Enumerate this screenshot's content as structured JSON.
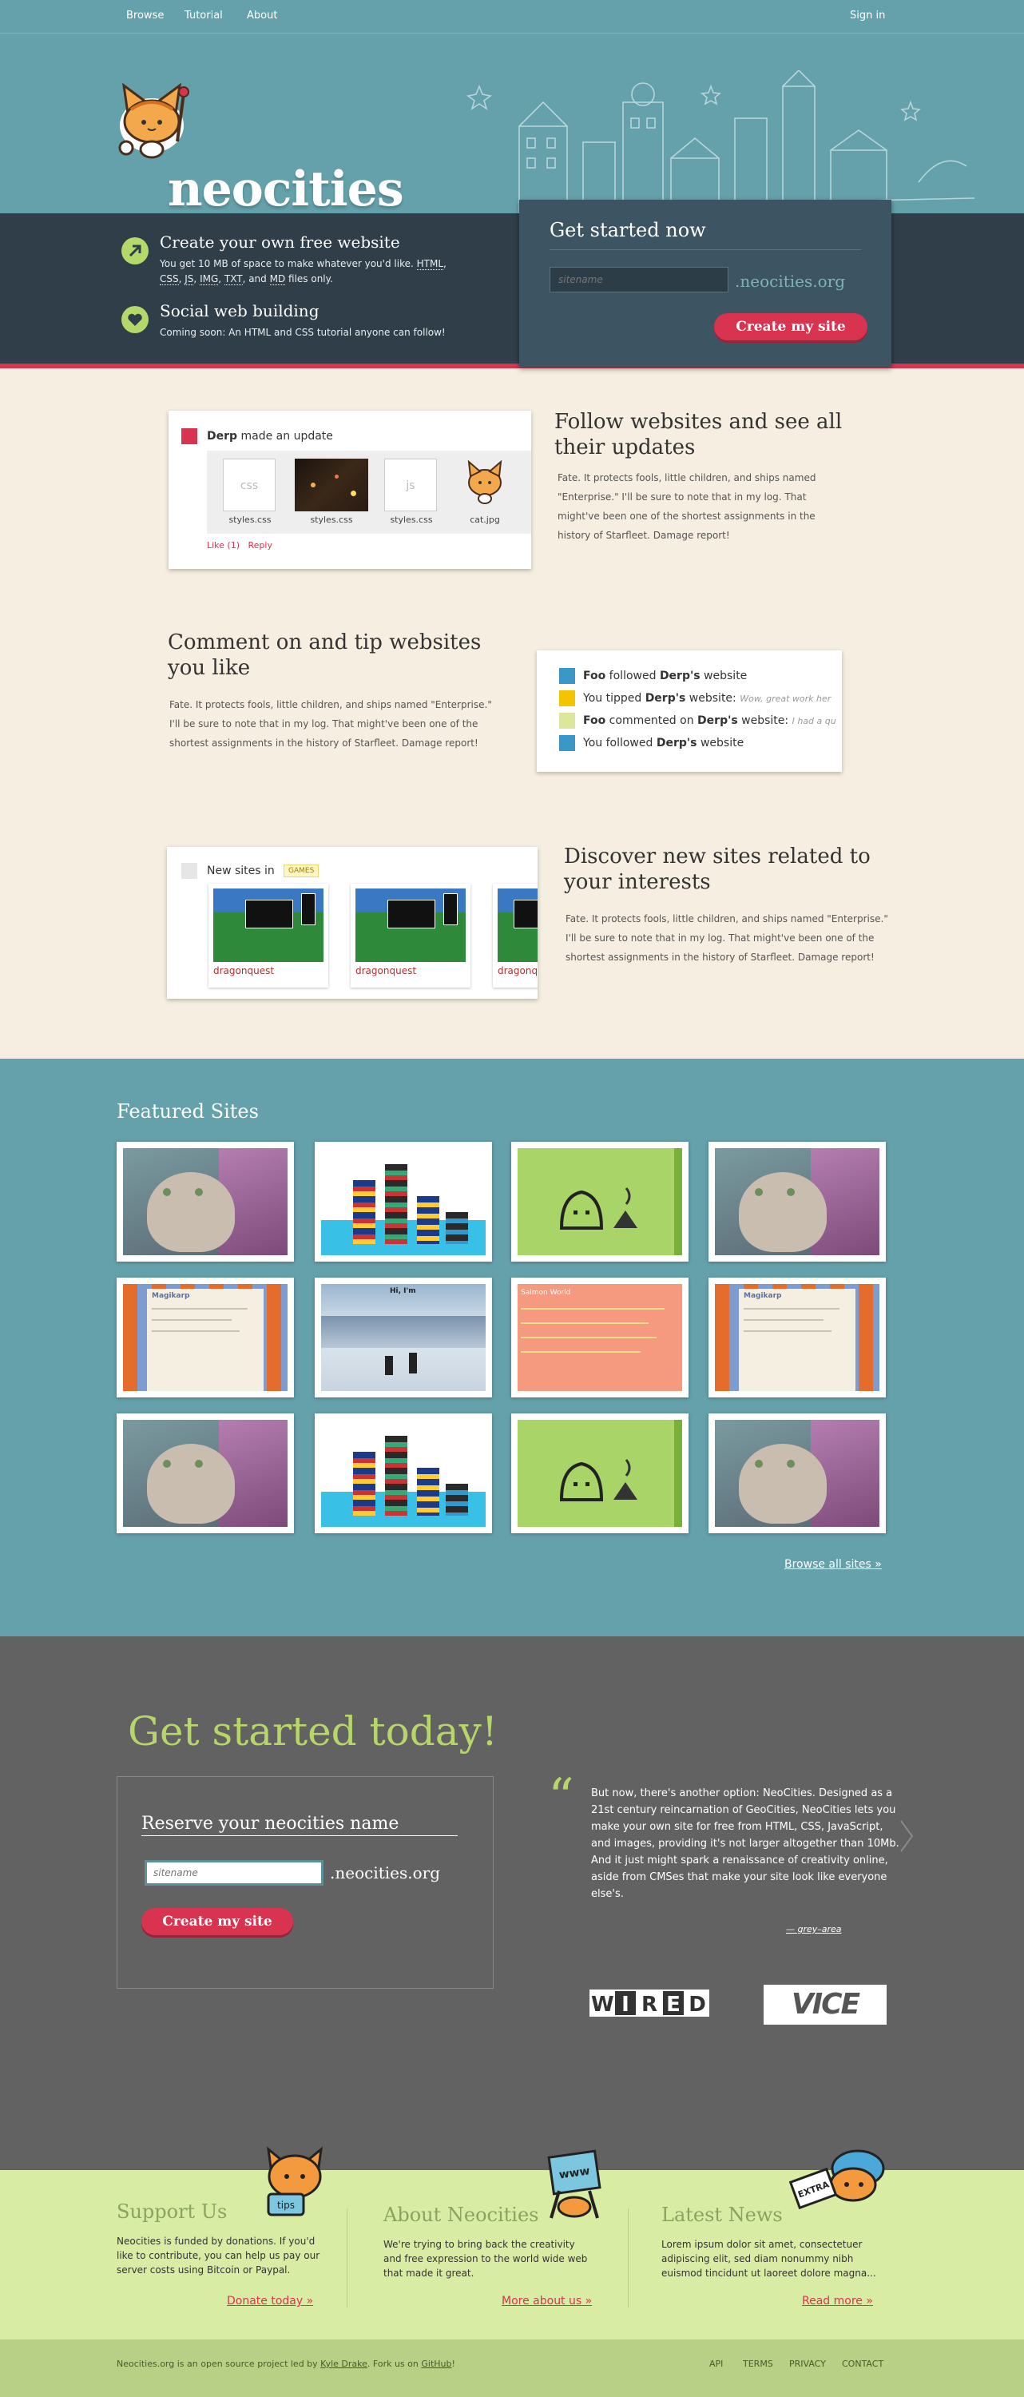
{
  "nav": {
    "browse": "Browse",
    "tutorial": "Tutorial",
    "about": "About",
    "signin": "Sign in"
  },
  "brand": {
    "name": "neocities"
  },
  "features": [
    {
      "title": "Create your own free website",
      "text_pre": "You get 10 MB of space to make whatever you'd like. ",
      "types": [
        "HTML",
        "CSS",
        "JS",
        "IMG",
        "TXT",
        "MD"
      ],
      "text_post": " files only."
    },
    {
      "title": "Social web building",
      "text": "Coming soon: An HTML and CSS tutorial anyone can follow!"
    }
  ],
  "get_started": {
    "title": "Get started now",
    "placeholder": "sitename",
    "suffix": ".neocities.org",
    "button": "Create my site"
  },
  "row1": {
    "card": {
      "user": "Derp",
      "action": "made an update",
      "files": [
        {
          "label": "css",
          "name": "styles.css"
        },
        {
          "label": "",
          "name": "styles.css"
        },
        {
          "label": "js",
          "name": "styles.css"
        },
        {
          "label": "",
          "name": "cat.jpg"
        }
      ],
      "like": "Like (1)",
      "reply": "Reply"
    },
    "title": "Follow websites and see all their updates",
    "text": "Fate. It protects fools, little children, and ships named \"Enterprise.\" I'll be sure to note that in my log. That might've been one of the shortest assignments in the history of Starfleet. Damage report!"
  },
  "row2": {
    "title": "Comment on and tip websites you like",
    "text": "Fate. It protects fools, little children, and ships named \"Enterprise.\" I'll be sure to note that in my log. That might've been one of the shortest assignments in the history of Starfleet. Damage report!",
    "events": [
      {
        "color": "#3a97c8",
        "a": "Foo",
        "b": " followed ",
        "c": "Derp's",
        "d": " website",
        "e": ""
      },
      {
        "color": "#f5c400",
        "a": "",
        "b": "You tipped ",
        "c": "Derp's",
        "d": " website: ",
        "e": "Wow, great work her"
      },
      {
        "color": "#dde79b",
        "a": "Foo",
        "b": " commented on ",
        "c": "Derp's",
        "d": " website: ",
        "e": "I had a qu"
      },
      {
        "color": "#3a97c8",
        "a": "",
        "b": "You followed ",
        "c": "Derp's",
        "d": " website",
        "e": ""
      }
    ]
  },
  "row3": {
    "card": {
      "label": "New sites in",
      "tag": "GAMES",
      "sites": [
        "dragonquest",
        "dragonquest",
        "dragonqu"
      ]
    },
    "title": "Discover new sites related to your interests",
    "text": "Fate. It protects fools, little children, and ships named \"Enterprise.\" I'll be sure to note that in my log. That might've been one of the shortest assignments in the history of Starfleet. Damage report!"
  },
  "featured": {
    "title": "Featured Sites",
    "browse_all": "Browse all sites »",
    "thumbs": [
      "cat",
      "tower",
      "green",
      "cat",
      "magikarp",
      "snow",
      "salmon",
      "magikarp",
      "cat",
      "tower",
      "green",
      "cat"
    ]
  },
  "thumb_text": {
    "magikarp": "Magikarp",
    "snow": "Hi, I'm",
    "salmon": "Salmon World"
  },
  "today": {
    "title": "Get started today!",
    "reserve": "Reserve  your neocities name",
    "placeholder": "sitename",
    "suffix": ".neocities.org",
    "button": "Create my site",
    "quote": "But now, there's another option: NeoCities. Designed as a 21st century reincarnation of GeoCities, NeoCities lets you make your own site for free from HTML, CSS, JavaScript, and images, providing it's not larger altogether than 10Mb. And it just might spark a renaissance of creativity online, aside from CMSes that make your site look like everyone else's.",
    "source": "— grey–area",
    "wired": [
      "W",
      "I",
      "R",
      "E",
      "D"
    ],
    "vice": "VICE"
  },
  "footer": {
    "support": {
      "title": "Support Us",
      "text": "Neocities is funded by donations. If you'd like to contribute, you can help us pay our server costs using Bitcoin or Paypal.",
      "link": "Donate today »"
    },
    "about": {
      "title": "About Neocities",
      "text": "We're trying to bring back the creativity and free expression to the world wide web that made it great.",
      "link": "More about us »"
    },
    "news": {
      "title": "Latest News",
      "text": "Lorem ipsum dolor sit amet, consectetuer adipiscing elit, sed diam nonummy nibh euismod tincidunt ut laoreet dolore magna...",
      "link": "Read more »"
    },
    "mascot_texts": {
      "tips": "tips",
      "www": "www",
      "extra": "EXTRA"
    }
  },
  "bottom": {
    "pre": "Neocities.org is an open source project led by ",
    "author": "Kyle Drake",
    "mid": ". Fork us on ",
    "github": "GitHub",
    "post": "!",
    "links": [
      "API",
      "TERMS",
      "PRIVACY",
      "CONTACT"
    ]
  },
  "colors": {
    "teal": "#64a1ab",
    "dark": "#2f3e48",
    "red": "#d8344f",
    "cream": "#f5eee1",
    "lime": "#d9eca4",
    "gray": "#626262"
  }
}
